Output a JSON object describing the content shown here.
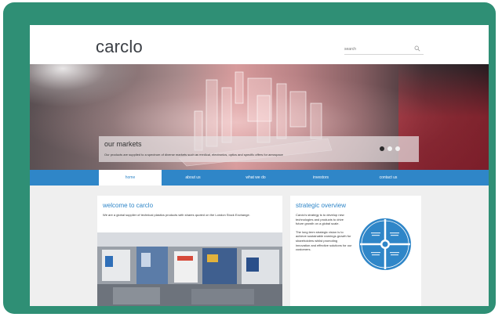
{
  "site": {
    "logo": "carclo",
    "search_placeholder": "search"
  },
  "hero": {
    "title": "our markets",
    "subtitle": "Our products are supplied to a spectrum of diverse markets such as medical, electronics, optics and specific offers for aerospace",
    "slides": 3,
    "active_slide": 1
  },
  "nav": {
    "items": [
      {
        "label": "home"
      },
      {
        "label": "about us"
      },
      {
        "label": "what we do"
      },
      {
        "label": "investors"
      },
      {
        "label": "contact us"
      }
    ],
    "active": "home"
  },
  "welcome": {
    "title": "welcome to carclo",
    "text": "We are a global supplier of technical plastics products with shares quoted on the London Stock Exchange."
  },
  "strategy": {
    "title": "strategic overview",
    "text1": "Carclo's strategy is to develop new technologies and products to drive future growth on a global scale.",
    "text2": "The long term strategic vision is to achieve sustainable earnings growth for shareholders whilst promoting innovation and effective solutions for our customers."
  },
  "colors": {
    "frame": "#2f8f75",
    "accent": "#2f86c8",
    "page_bg": "#efefef"
  },
  "icons": [
    "search-icon",
    "strategy-wheel-icon"
  ]
}
